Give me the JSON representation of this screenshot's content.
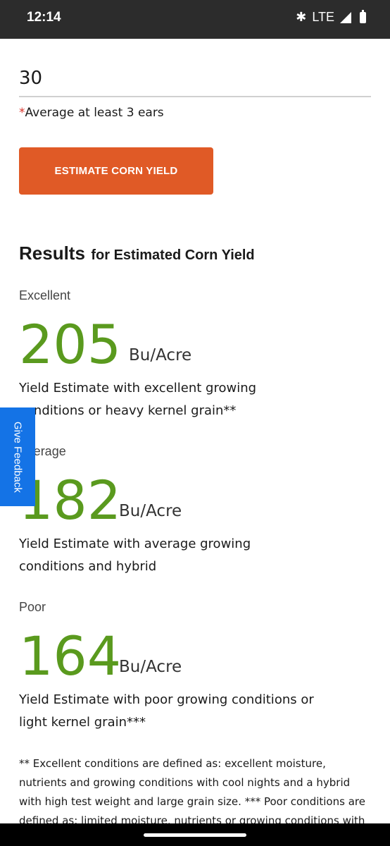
{
  "status_bar": {
    "time": "12:14",
    "network": "LTE",
    "icons": [
      "bluetooth-icon",
      "signal-icon",
      "battery-icon"
    ]
  },
  "form": {
    "ears_value": "30",
    "ears_hint_required": "*",
    "ears_hint": "Average at least 3 ears",
    "button_label": "ESTIMATE CORN YIELD"
  },
  "results": {
    "title_big": "Results",
    "title_small": "for Estimated Corn Yield",
    "unit": "Bu/Acre",
    "items": [
      {
        "label": "Excellent",
        "value": "205",
        "description": "Yield Estimate with excellent growing conditions or heavy kernel grain**"
      },
      {
        "label": "Average",
        "value": "182",
        "description": "Yield Estimate with average growing conditions and hybrid"
      },
      {
        "label": "Poor",
        "value": "164",
        "description": "Yield Estimate with poor growing conditions or light kernel grain***"
      }
    ]
  },
  "footnote": "** Excellent conditions are defined as: excellent moisture, nutrients and growing conditions with cool nights and a hybrid with high test weight and large grain size. *** Poor conditions are defined as: limited moisture, nutrients or growing conditions with",
  "feedback_tab": "Give Feedback",
  "colors": {
    "accent_button": "#e05a26",
    "yield_green": "#5a9a1e",
    "feedback_blue": "#1473e6"
  }
}
